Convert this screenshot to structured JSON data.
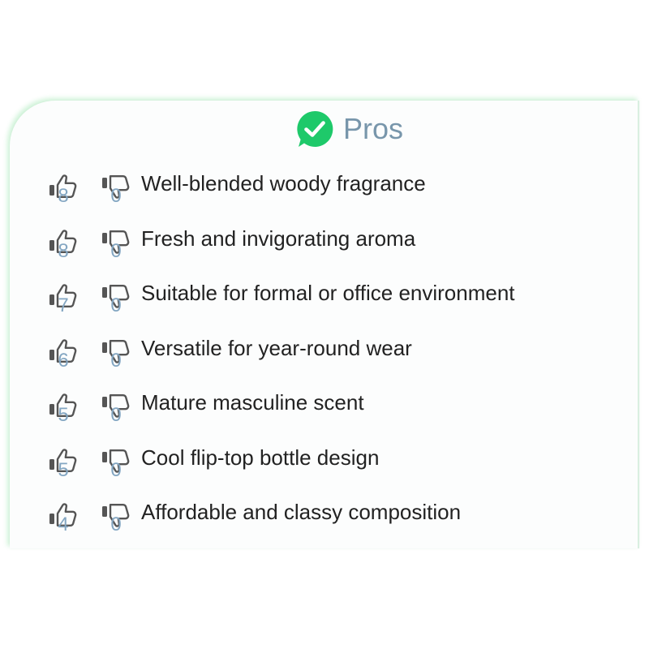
{
  "section": {
    "title": "Pros",
    "icon": "check-speech-bubble-icon",
    "accent": "#1ec96a"
  },
  "pros": [
    {
      "text": "Well-blended woody fragrance",
      "likes": "8",
      "dislikes": "0"
    },
    {
      "text": "Fresh and invigorating aroma",
      "likes": "8",
      "dislikes": "0"
    },
    {
      "text": "Suitable for formal or office environment",
      "likes": "7",
      "dislikes": "0"
    },
    {
      "text": "Versatile for year-round wear",
      "likes": "6",
      "dislikes": "0"
    },
    {
      "text": "Mature masculine scent",
      "likes": "5",
      "dislikes": "0"
    },
    {
      "text": "Cool flip-top bottle design",
      "likes": "5",
      "dislikes": "0"
    },
    {
      "text": "Affordable and classy composition",
      "likes": "4",
      "dislikes": "0"
    }
  ],
  "icons": {
    "like": "thumbs-up-icon",
    "dislike": "thumbs-down-icon"
  }
}
